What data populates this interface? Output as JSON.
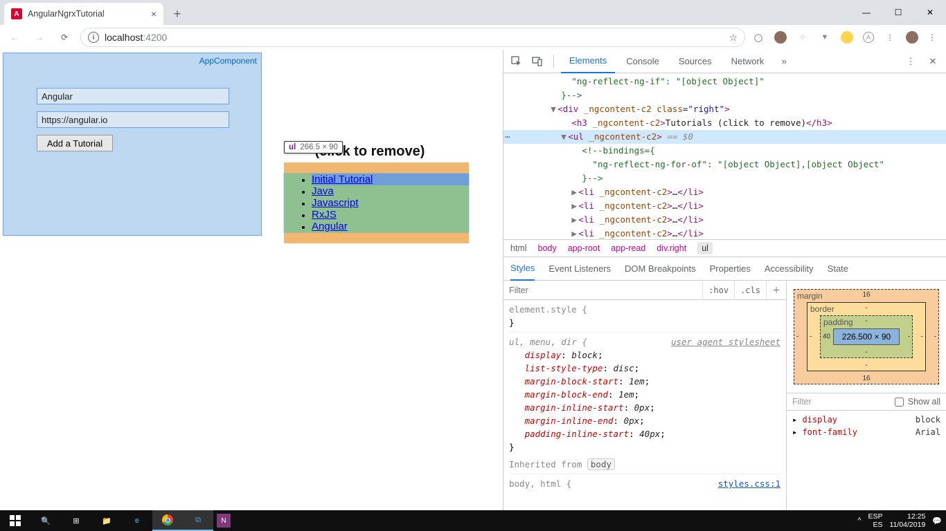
{
  "browser": {
    "tab_title": "AngularNgrxTutorial",
    "url_host": "localhost",
    "url_port": ":4200"
  },
  "app": {
    "component_label": "AppComponent",
    "input_name": "Angular",
    "input_url": "https://angular.io",
    "add_button": "Add a Tutorial",
    "list_heading_visible": "(click to remove)",
    "tutorials": [
      "Initial Tutorial",
      "Java",
      "Javascript",
      "RxJS",
      "Angular"
    ],
    "hover_tag": "ul",
    "hover_dim": "266.5 × 90"
  },
  "devtools": {
    "tabs": [
      "Elements",
      "Console",
      "Sources",
      "Network"
    ],
    "dom": {
      "binding_if": "\"ng-reflect-ng-if\": \"[object Object]\"",
      "close_cmt": "}-->",
      "div_open": "<div _ngcontent-c2 class=\"right\">",
      "h3_open": "<h3 _ngcontent-c2>",
      "h3_text": "Tutorials (click to remove)",
      "h3_close": "</h3>",
      "ul_open": "<ul _ngcontent-c2>",
      "ul_sel": " == $0",
      "bindings_open": "<!--bindings={",
      "ngfor": "\"ng-reflect-ng-for-of\": \"[object Object],[object Object\"",
      "li": "<li _ngcontent-c2>…</li>"
    },
    "crumbs": [
      "html",
      "body",
      "app-root",
      "app-read",
      "div.right",
      "ul"
    ],
    "subtabs": [
      "Styles",
      "Event Listeners",
      "DOM Breakpoints",
      "Properties",
      "Accessibility",
      "State"
    ],
    "filter_placeholder": "Filter",
    "hov": ":hov",
    "cls": ".cls",
    "rules": {
      "elstyle_sel": "element.style {",
      "ul_sel": "ul, menu, dir {",
      "ua_label": "user agent stylesheet",
      "props": [
        {
          "k": "display",
          "v": "block"
        },
        {
          "k": "list-style-type",
          "v": "disc"
        },
        {
          "k": "margin-block-start",
          "v": "1em"
        },
        {
          "k": "margin-block-end",
          "v": "1em"
        },
        {
          "k": "margin-inline-start",
          "v": "0px"
        },
        {
          "k": "margin-inline-end",
          "v": "0px"
        },
        {
          "k": "padding-inline-start",
          "v": "40px"
        }
      ],
      "inherited_label": "Inherited from",
      "inherited_from": "body",
      "body_sel": "body, html {",
      "body_src": "styles.css:1"
    },
    "boxmodel": {
      "margin_label": "margin",
      "border_label": "border",
      "padding_label": "padding",
      "margin_t": "16",
      "margin_b": "16",
      "margin_l": "-",
      "margin_r": "-",
      "border_all": "-",
      "padding_l": "40",
      "padding_t": "-",
      "padding_b": "-",
      "padding_r": "-",
      "content": "226.500 × 90"
    },
    "comp_filter_label": "Filter",
    "comp_showall": "Show all",
    "computed": [
      {
        "k": "display",
        "v": "block"
      },
      {
        "k": "font-family",
        "v": "Arial"
      }
    ]
  },
  "taskbar": {
    "lang": "ESP",
    "kb": "ES",
    "time": "12:25",
    "date": "11/04/2019"
  }
}
